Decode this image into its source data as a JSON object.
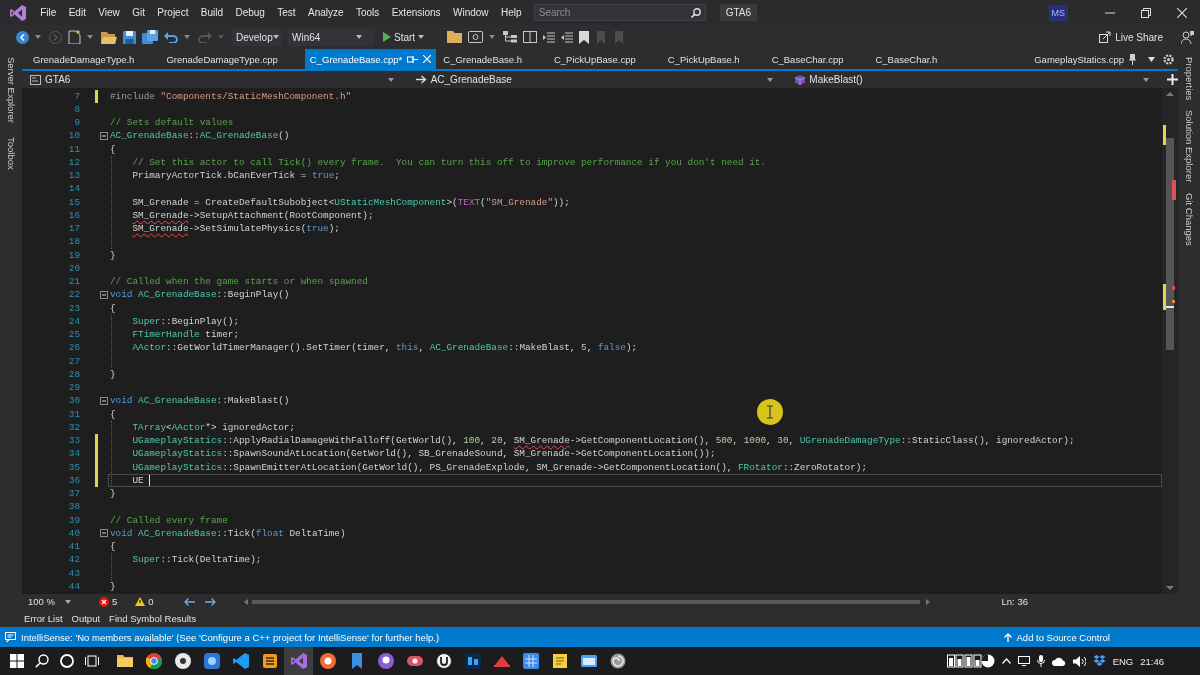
{
  "menu_bar": {
    "items": [
      "File",
      "Edit",
      "View",
      "Git",
      "Project",
      "Build",
      "Debug",
      "Test",
      "Analyze",
      "Tools",
      "Extensions",
      "Window",
      "Help"
    ],
    "search": {
      "placeholder": "Search"
    },
    "solution_name": "GTA6",
    "account_initials": "MS"
  },
  "toolbar": {
    "configuration": "Develop",
    "platform": "Win64",
    "start_button": "Start",
    "live_share": "Live Share"
  },
  "left_tool_strip": [
    "Server Explorer",
    "Toolbox"
  ],
  "document_tabs": [
    {
      "label": "GrenadeDamageType.h",
      "selected": false,
      "pinned": false
    },
    {
      "label": "GrenadeDamageType.cpp",
      "selected": false,
      "pinned": false
    },
    {
      "label": "C_GrenadeBase.cpp*",
      "selected": true,
      "pinned": false
    },
    {
      "label": "C_GrenadeBase.h",
      "selected": false,
      "pinned": false
    },
    {
      "label": "C_PickUpBase.cpp",
      "selected": false,
      "pinned": false
    },
    {
      "label": "C_PickUpBase.h",
      "selected": false,
      "pinned": false
    },
    {
      "label": "C_BaseChar.cpp",
      "selected": false,
      "pinned": false
    },
    {
      "label": "C_BaseChar.h",
      "selected": false,
      "pinned": false
    },
    {
      "label": "GameplayStatics.cpp",
      "selected": false,
      "pinned": true
    }
  ],
  "navigation_bar": {
    "project": "GTA6",
    "scope": "AC_GrenadeBase",
    "member": "MakeBlast()"
  },
  "editor": {
    "lines": [
      {
        "number": "7",
        "current": false,
        "modified": true,
        "tokens": [
          {
            "kind": "directive",
            "text": "#include "
          },
          {
            "kind": "string",
            "text": "\"Components/StaticMeshComponent.h\""
          }
        ]
      },
      {
        "number": "8",
        "current": false,
        "modified": false
      },
      {
        "number": "9",
        "current": false,
        "modified": false,
        "tokens": [
          {
            "kind": "comment",
            "text": "// Sets default values"
          }
        ]
      },
      {
        "number": "10",
        "current": false,
        "modified": false,
        "expanded": true,
        "tokens": [
          {
            "kind": "type",
            "text": "AC_GrenadeBase"
          },
          {
            "kind": "plain",
            "text": "::"
          },
          {
            "kind": "type",
            "text": "AC_GrenadeBase"
          },
          {
            "kind": "plain",
            "text": "()"
          }
        ]
      },
      {
        "number": "11",
        "current": false,
        "modified": false,
        "tokens": [
          {
            "kind": "plain",
            "text": "{"
          }
        ],
        "children": [
          {
            "number": "12",
            "current": false,
            "modified": false,
            "tokens": [
              {
                "kind": "comment",
                "text": "// Set this actor to call Tick() every frame.  You can turn this off to improve performance if you don't need it."
              }
            ]
          },
          {
            "number": "13",
            "current": false,
            "modified": false,
            "tokens": [
              {
                "kind": "plain",
                "text": "PrimaryActorTick.bCanEverTick = "
              },
              {
                "kind": "keyword",
                "text": "true"
              },
              {
                "kind": "plain",
                "text": ";"
              }
            ]
          },
          {
            "number": "14",
            "current": false,
            "modified": false
          },
          {
            "number": "15",
            "current": false,
            "modified": false,
            "tokens": [
              {
                "kind": "plain",
                "text": "SM_Grenade = CreateDefaultSubobject<"
              },
              {
                "kind": "type",
                "text": "UStaticMeshComponent"
              },
              {
                "kind": "plain",
                "text": ">("
              },
              {
                "kind": "macro",
                "text": "TEXT"
              },
              {
                "kind": "plain",
                "text": "("
              },
              {
                "kind": "string",
                "text": "\"SM_Grenade\""
              },
              {
                "kind": "plain",
                "text": "));"
              }
            ]
          },
          {
            "number": "16",
            "current": false,
            "modified": false,
            "tokens": [
              {
                "kind": "flagged",
                "text": "SM_Grenade"
              },
              {
                "kind": "plain",
                "text": "->SetupAttachment(RootComponent);"
              }
            ]
          },
          {
            "number": "17",
            "current": false,
            "modified": false,
            "tokens": [
              {
                "kind": "flagged",
                "text": "SM_Grenade"
              },
              {
                "kind": "plain",
                "text": "->SetSimulatePhysics("
              },
              {
                "kind": "keyword",
                "text": "true"
              },
              {
                "kind": "plain",
                "text": ");"
              }
            ]
          },
          {
            "number": "18",
            "current": false,
            "modified": false
          }
        ]
      },
      {
        "number": "19",
        "current": false,
        "modified": false,
        "tokens": [
          {
            "kind": "plain",
            "text": "}"
          }
        ]
      },
      {
        "number": "20",
        "current": false,
        "modified": false
      },
      {
        "number": "21",
        "current": false,
        "modified": false,
        "tokens": [
          {
            "kind": "comment",
            "text": "// Called when the game starts or when spawned"
          }
        ]
      },
      {
        "number": "22",
        "current": false,
        "modified": false,
        "expanded": true,
        "tokens": [
          {
            "kind": "keyword",
            "text": "void "
          },
          {
            "kind": "type",
            "text": "AC_GrenadeBase"
          },
          {
            "kind": "plain",
            "text": "::BeginPlay()"
          }
        ]
      },
      {
        "number": "23",
        "current": false,
        "modified": false,
        "tokens": [
          {
            "kind": "plain",
            "text": "{"
          }
        ],
        "children": [
          {
            "number": "24",
            "current": false,
            "modified": false,
            "tokens": [
              {
                "kind": "type",
                "text": "Super"
              },
              {
                "kind": "plain",
                "text": "::BeginPlay();"
              }
            ]
          },
          {
            "number": "25",
            "current": false,
            "modified": false,
            "tokens": [
              {
                "kind": "type",
                "text": "FTimerHandle"
              },
              {
                "kind": "plain",
                "text": " timer;"
              }
            ]
          },
          {
            "number": "26",
            "current": false,
            "modified": false,
            "tokens": [
              {
                "kind": "type",
                "text": "AActor"
              },
              {
                "kind": "plain",
                "text": "::GetWorldTimerManager().SetTimer(timer, "
              },
              {
                "kind": "keyword",
                "text": "this"
              },
              {
                "kind": "plain",
                "text": ", "
              },
              {
                "kind": "type",
                "text": "AC_GrenadeBase"
              },
              {
                "kind": "plain",
                "text": "::MakeBlast, "
              },
              {
                "kind": "number",
                "text": "5"
              },
              {
                "kind": "plain",
                "text": ", "
              },
              {
                "kind": "keyword",
                "text": "false"
              },
              {
                "kind": "plain",
                "text": ");"
              }
            ]
          },
          {
            "number": "27",
            "current": false,
            "modified": false
          }
        ]
      },
      {
        "number": "28",
        "current": false,
        "modified": false,
        "tokens": [
          {
            "kind": "plain",
            "text": "}"
          }
        ]
      },
      {
        "number": "29",
        "current": false,
        "modified": false
      },
      {
        "number": "30",
        "current": false,
        "modified": false,
        "expanded": true,
        "tokens": [
          {
            "kind": "keyword",
            "text": "void "
          },
          {
            "kind": "type",
            "text": "AC_GrenadeBase"
          },
          {
            "kind": "plain",
            "text": "::MakeBlast()"
          }
        ]
      },
      {
        "number": "31",
        "current": false,
        "modified": false,
        "tokens": [
          {
            "kind": "plain",
            "text": "{"
          }
        ],
        "children": [
          {
            "number": "32",
            "current": false,
            "modified": false,
            "tokens": [
              {
                "kind": "type",
                "text": "TArray"
              },
              {
                "kind": "plain",
                "text": "<"
              },
              {
                "kind": "type",
                "text": "AActor"
              },
              {
                "kind": "plain",
                "text": "*> ignoredActor;"
              }
            ]
          },
          {
            "number": "33",
            "current": false,
            "modified": true,
            "tokens": [
              {
                "kind": "type",
                "text": "UGameplayStatics"
              },
              {
                "kind": "plain",
                "text": "::ApplyRadialDamageWithFalloff(GetWorld(), "
              },
              {
                "kind": "number",
                "text": "100"
              },
              {
                "kind": "plain",
                "text": ", "
              },
              {
                "kind": "number",
                "text": "20"
              },
              {
                "kind": "plain",
                "text": ", "
              },
              {
                "kind": "flagged",
                "text": "SM_Grenade"
              },
              {
                "kind": "plain",
                "text": "->GetComponentLocation(), "
              },
              {
                "kind": "number",
                "text": "500"
              },
              {
                "kind": "plain",
                "text": ", "
              },
              {
                "kind": "number",
                "text": "1000"
              },
              {
                "kind": "plain",
                "text": ", "
              },
              {
                "kind": "number",
                "text": "30"
              },
              {
                "kind": "plain",
                "text": ", "
              },
              {
                "kind": "type",
                "text": "UGrenadeDamageType"
              },
              {
                "kind": "plain",
                "text": "::StaticClass(), ignoredActor);"
              }
            ]
          },
          {
            "number": "34",
            "current": false,
            "modified": true,
            "tokens": [
              {
                "kind": "type",
                "text": "UGameplayStatics"
              },
              {
                "kind": "plain",
                "text": "::SpawnSoundAtLocation(GetWorld(), SB_GrenadeSound, SM_Grenade->GetComponentLocation());"
              }
            ]
          },
          {
            "number": "35",
            "current": false,
            "modified": true,
            "tokens": [
              {
                "kind": "type",
                "text": "UGameplayStatics"
              },
              {
                "kind": "plain",
                "text": "::SpawnEmitterAtLocation(GetWorld(), PS_GrenadeExplode, SM_Grenade->GetComponentLocation(), "
              },
              {
                "kind": "type",
                "text": "FRotator"
              },
              {
                "kind": "plain",
                "text": "::ZeroRotator);"
              }
            ]
          },
          {
            "number": "36",
            "current": true,
            "modified": true,
            "tokens": [
              {
                "kind": "plain",
                "text": "UE"
              }
            ]
          }
        ]
      },
      {
        "number": "37",
        "current": false,
        "modified": false,
        "tokens": [
          {
            "kind": "plain",
            "text": "}"
          }
        ]
      },
      {
        "number": "38",
        "current": false,
        "modified": false
      },
      {
        "number": "39",
        "current": false,
        "modified": false,
        "tokens": [
          {
            "kind": "comment",
            "text": "// Called every frame"
          }
        ]
      },
      {
        "number": "40",
        "current": false,
        "modified": false,
        "expanded": true,
        "tokens": [
          {
            "kind": "keyword",
            "text": "void "
          },
          {
            "kind": "type",
            "text": "AC_GrenadeBase"
          },
          {
            "kind": "plain",
            "text": "::Tick("
          },
          {
            "kind": "keyword",
            "text": "float"
          },
          {
            "kind": "plain",
            "text": " DeltaTime)"
          }
        ]
      },
      {
        "number": "41",
        "current": false,
        "modified": false,
        "tokens": [
          {
            "kind": "plain",
            "text": "{"
          }
        ],
        "children": [
          {
            "number": "42",
            "current": false,
            "modified": false,
            "tokens": [
              {
                "kind": "type",
                "text": "Super"
              },
              {
                "kind": "plain",
                "text": "::Tick(DeltaTime);"
              }
            ]
          },
          {
            "number": "43",
            "current": false,
            "modified": false
          }
        ]
      },
      {
        "number": "44",
        "current": false,
        "modified": false,
        "tokens": [
          {
            "kind": "plain",
            "text": "}"
          }
        ]
      }
    ]
  },
  "editor_status": {
    "zoom": "100 %",
    "errors": "5",
    "warnings": "0",
    "position": "Ln: 36"
  },
  "right_tool_strip": [
    "Properties",
    "Solution Explorer",
    "Git Changes"
  ],
  "tool_window_tabs": [
    "Error List",
    "Output",
    "Find Symbol Results"
  ],
  "status_bar": {
    "message": "IntelliSense: 'No members available' (See 'Configure a C++ project for IntelliSense' for further help.)",
    "source_control": "Add to Source Control"
  },
  "taskbar": {
    "apps": [
      {
        "selected": false
      },
      {
        "selected": false
      },
      {
        "selected": false
      },
      {
        "selected": false
      },
      {
        "selected": false
      },
      {
        "selected": false
      },
      {
        "selected": true
      },
      {
        "selected": false
      },
      {
        "selected": false
      },
      {
        "selected": false
      },
      {
        "selected": false
      },
      {
        "selected": false
      },
      {
        "selected": false
      },
      {
        "selected": false
      },
      {
        "selected": false
      },
      {
        "selected": false
      },
      {
        "selected": false
      },
      {
        "selected": false
      }
    ],
    "language": "ENG",
    "time": "21:46"
  }
}
